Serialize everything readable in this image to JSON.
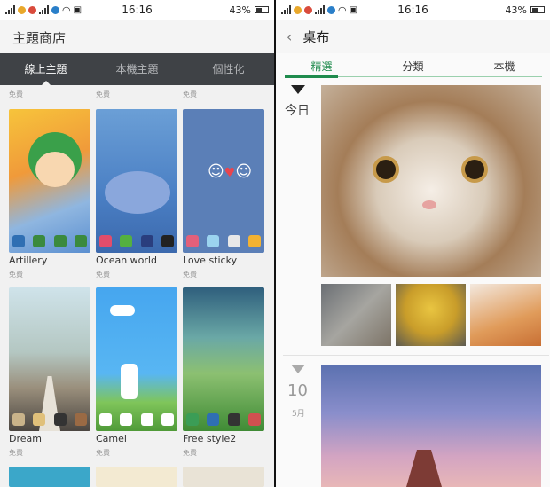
{
  "left": {
    "status": {
      "time": "16:16",
      "battery": "43%"
    },
    "title": "主題商店",
    "tabs": [
      "線上主題",
      "本機主題",
      "個性化"
    ],
    "free_label": "免費",
    "themes": [
      {
        "name": "Artillery"
      },
      {
        "name": "Ocean world"
      },
      {
        "name": "Love sticky"
      },
      {
        "name": "Dream"
      },
      {
        "name": "Camel"
      },
      {
        "name": "Free style2"
      }
    ]
  },
  "right": {
    "status": {
      "time": "16:16",
      "battery": "43%"
    },
    "title": "桌布",
    "tabs": [
      "精選",
      "分類",
      "本機"
    ],
    "groups": [
      {
        "day": "今日",
        "month": ""
      },
      {
        "day": "10",
        "month": "5月"
      }
    ]
  },
  "colors": {
    "accent": "#1f8b4d",
    "tabbar": "#3f4246"
  }
}
